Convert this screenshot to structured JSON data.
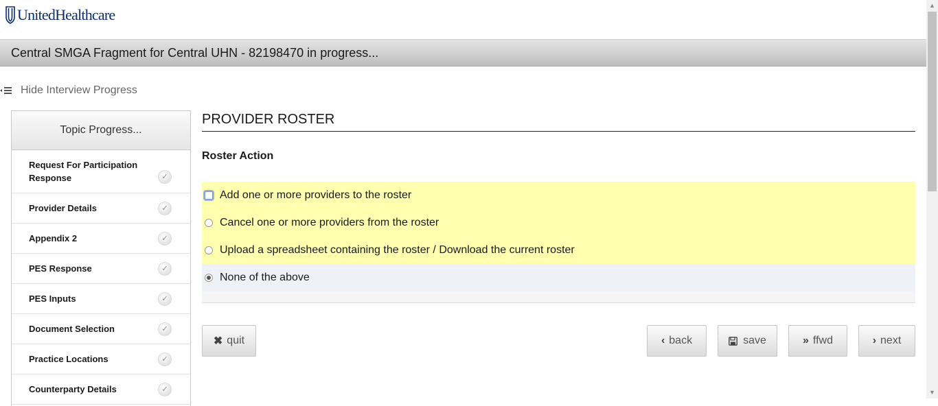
{
  "brand": {
    "name": "UnitedHealthcare"
  },
  "header": {
    "title": "Central SMGA Fragment for Central UHN - 82198470 in progress..."
  },
  "progress_toggle": {
    "label": "Hide Interview Progress"
  },
  "sidebar": {
    "heading": "Topic Progress...",
    "topics": [
      {
        "label": "Request For Participation Response",
        "status": "complete"
      },
      {
        "label": "Provider Details",
        "status": "complete"
      },
      {
        "label": "Appendix 2",
        "status": "complete"
      },
      {
        "label": "PES Response",
        "status": "complete"
      },
      {
        "label": "PES Inputs",
        "status": "complete"
      },
      {
        "label": "Document Selection",
        "status": "complete"
      },
      {
        "label": "Practice Locations",
        "status": "complete"
      },
      {
        "label": "Counterparty Details",
        "status": "complete"
      }
    ]
  },
  "main": {
    "section_title": "PROVIDER ROSTER",
    "question": "Roster Action",
    "options": [
      {
        "label": "Add one or more providers to the roster",
        "selected": false
      },
      {
        "label": "Cancel one or more providers from the roster",
        "selected": false
      },
      {
        "label": "Upload a spreadsheet containing the roster / Download the current roster",
        "selected": false
      },
      {
        "label": "None of the above",
        "selected": true
      }
    ]
  },
  "buttons": {
    "quit": "quit",
    "back": "back",
    "save": "save",
    "ffwd": "ffwd",
    "next": "next"
  },
  "colors": {
    "option_highlight": "#ffffb0",
    "selected_row": "#eef2f7",
    "brand_blue": "#0c2d6b"
  }
}
